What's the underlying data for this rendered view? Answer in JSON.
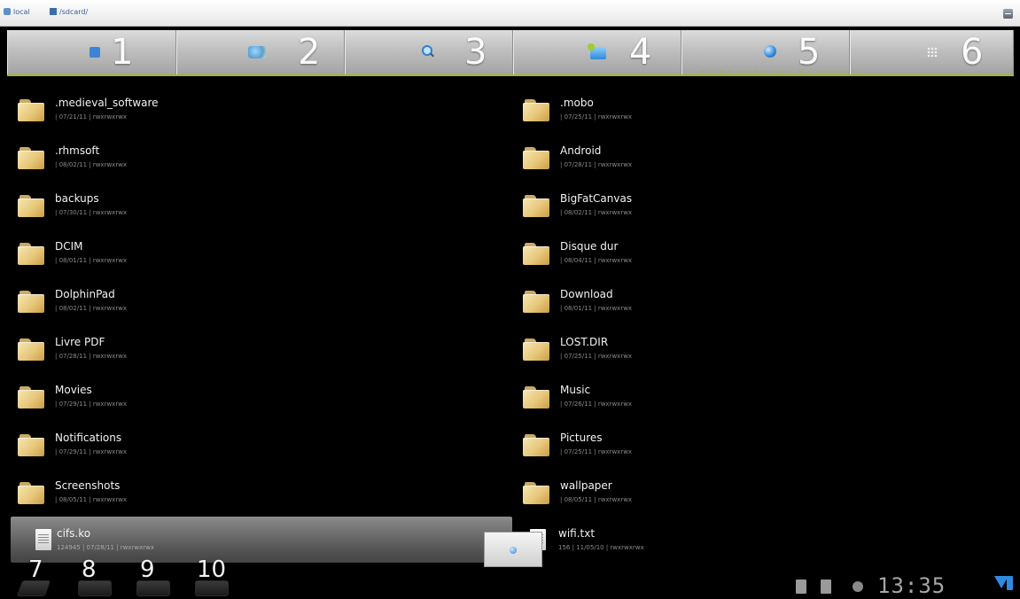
{
  "address_bar": {
    "items": [
      {
        "label": "local",
        "icon": "device-icon"
      },
      {
        "label": "/sdcard/",
        "icon": "folder-icon"
      }
    ]
  },
  "tabs": [
    {
      "number": "1",
      "icon": "square-icon"
    },
    {
      "number": "2",
      "icon": "photo-icon"
    },
    {
      "number": "3",
      "icon": "search-icon"
    },
    {
      "number": "4",
      "icon": "folder-icon"
    },
    {
      "number": "5",
      "icon": "globe-icon"
    },
    {
      "number": "6",
      "icon": "grid-icon"
    }
  ],
  "files_left": [
    {
      "name": ".medieval_software",
      "meta": "| 07/21/11 | rwxrwxrwx"
    },
    {
      "name": ".rhmsoft",
      "meta": "| 08/02/11 | rwxrwxrwx"
    },
    {
      "name": "backups",
      "meta": "| 07/30/11 | rwxrwxrwx"
    },
    {
      "name": "DCIM",
      "meta": "| 08/01/11 | rwxrwxrwx"
    },
    {
      "name": "DolphinPad",
      "meta": "| 08/02/11 | rwxrwxrwx"
    },
    {
      "name": "Livre PDF",
      "meta": "| 07/28/11 | rwxrwxrwx"
    },
    {
      "name": "Movies",
      "meta": "| 07/29/11 | rwxrwxrwx"
    },
    {
      "name": "Notifications",
      "meta": "| 07/29/11 | rwxrwxrwx"
    },
    {
      "name": "Screenshots",
      "meta": "| 08/05/11 | rwxrwxrwx"
    }
  ],
  "files_right": [
    {
      "name": ".mobo",
      "meta": "| 07/25/11 | rwxrwxrwx"
    },
    {
      "name": "Android",
      "meta": "| 07/28/11 | rwxrwxrwx"
    },
    {
      "name": "BigFatCanvas",
      "meta": "| 08/02/11 | rwxrwxrwx"
    },
    {
      "name": "Disque dur",
      "meta": "| 08/04/11 | rwxrwxrwx"
    },
    {
      "name": "Download",
      "meta": "| 08/01/11 | rwxrwxrwx"
    },
    {
      "name": "LOST.DIR",
      "meta": "| 07/25/11 | rwxrwxrwx"
    },
    {
      "name": "Music",
      "meta": "| 07/26/11 | rwxrwxrwx"
    },
    {
      "name": "Pictures",
      "meta": "| 07/25/11 | rwxrwxrwx"
    },
    {
      "name": "wallpaper",
      "meta": "| 08/05/11 | rwxrwxrwx"
    }
  ],
  "selected_file": {
    "name": "cifs.ko",
    "meta": "124945 | 07/28/11 | rwxrwxrwx"
  },
  "file_right_last": {
    "name": "wifi.txt",
    "meta": "156 | 11/05/10 | rwxrwxrwx"
  },
  "bottom_nav": {
    "numbers": [
      "7",
      "8",
      "9",
      "10"
    ],
    "icons": [
      "back-icon",
      "home-icon",
      "recent-apps-icon",
      "menu-icon"
    ]
  },
  "status": {
    "time": "13:35",
    "accent_color": "#2f8ae0"
  }
}
